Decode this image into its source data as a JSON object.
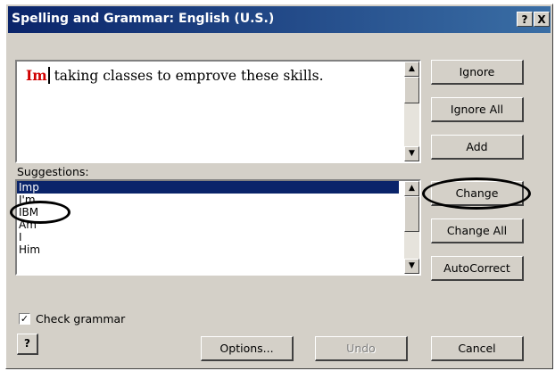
{
  "window": {
    "title": "Spelling and Grammar: English (U.S.)",
    "help_glyph": "?",
    "close_glyph": "X"
  },
  "sentence": {
    "error_word": "Im",
    "rest": " taking classes to emprove these skills."
  },
  "buttons": {
    "ignore": "Ignore",
    "ignore_all": "Ignore All",
    "add": "Add",
    "change": "Change",
    "change_all": "Change All",
    "autocorrect": "AutoCorrect",
    "options": "Options...",
    "undo": "Undo",
    "cancel": "Cancel"
  },
  "suggestions": {
    "label": "Suggestions:",
    "items": [
      "Imp",
      "I'm",
      "IBM",
      "Am",
      "I",
      "Him"
    ],
    "selected_index": 0
  },
  "check_grammar": {
    "label": "Check grammar",
    "checked": true
  },
  "icons": {
    "scroll_up": "scroll-up-arrow-icon",
    "scroll_down": "scroll-down-arrow-icon",
    "help": "help-book-icon"
  },
  "colors": {
    "titlebar_start": "#0a246a",
    "titlebar_end": "#3a6ea5",
    "dialog_face": "#d4d0c8",
    "selection": "#0a246a",
    "error_text": "#d00000"
  }
}
